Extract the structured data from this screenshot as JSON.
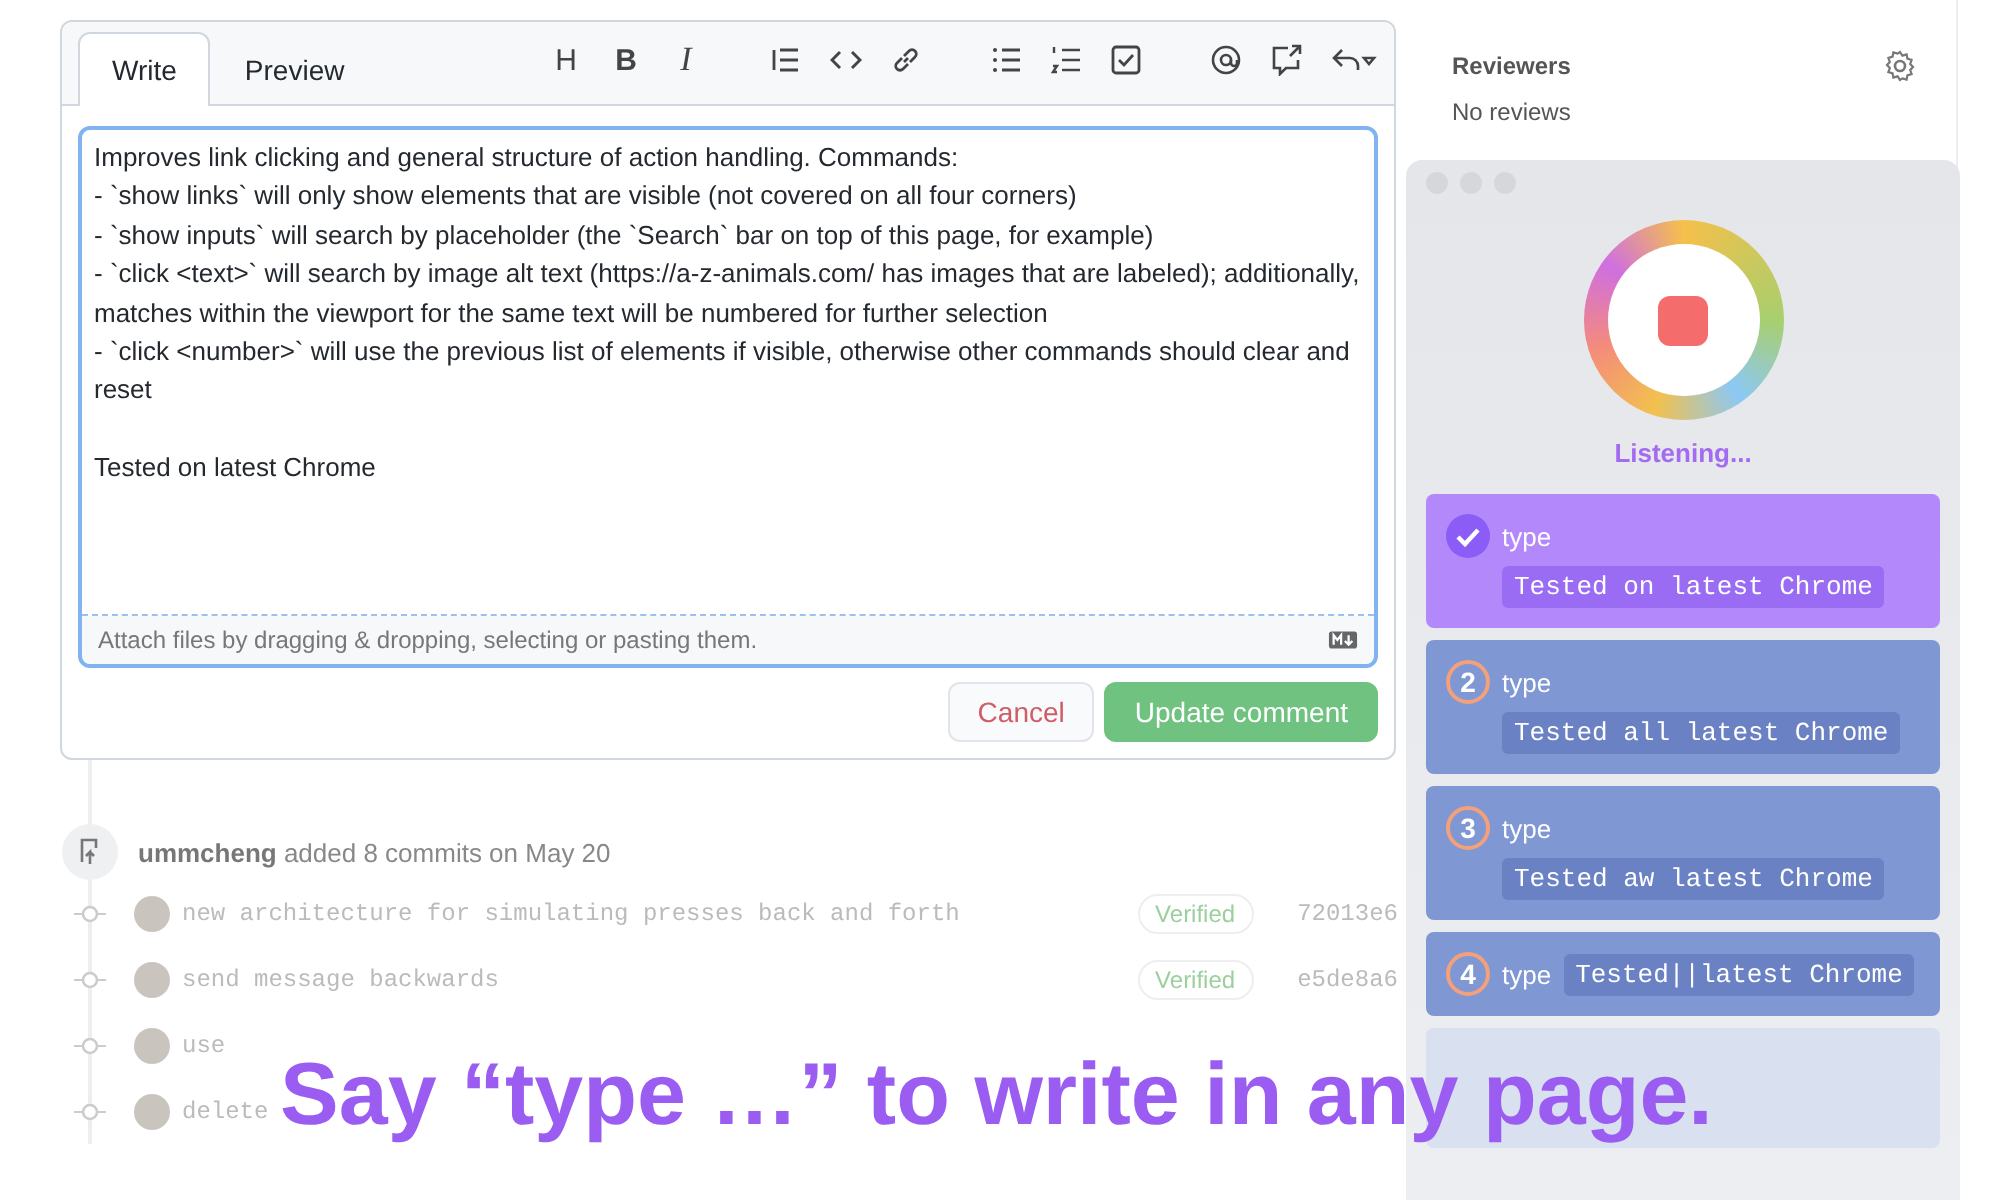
{
  "editor": {
    "tabs": [
      {
        "label": "Write",
        "selected": true
      },
      {
        "label": "Preview",
        "selected": false
      }
    ],
    "toolbar_letters": [
      "H",
      "B",
      "I"
    ],
    "text": "Improves link clicking and general structure of action handling. Commands:\n- `show links` will only show elements that are visible (not covered on all four corners)\n- `show inputs` will search by placeholder (the `Search` bar on top of this page, for example)\n- `click <text>` will search by image alt text (https://a-z-animals.com/ has images that are labeled); additionally, matches within the viewport for the same text will be numbered for further selection\n- `click <number>` will use the previous list of elements if visible, otherwise other commands should clear and reset\n\nTested on latest Chrome",
    "attach_hint": "Attach files by dragging & dropping, selecting or pasting them.",
    "buttons": [
      {
        "label": "Cancel",
        "kind": "secondary"
      },
      {
        "label": "Update comment",
        "kind": "primary"
      }
    ]
  },
  "timeline": {
    "event": {
      "user": "ummcheng",
      "action": "added 8 commits on May 20"
    },
    "commits": [
      {
        "message": "new architecture for simulating presses back and forth",
        "badge": "Verified",
        "hash": "72013e6"
      },
      {
        "message": "send message backwards",
        "badge": "Verified",
        "hash": "e5de8a6"
      },
      {
        "message": "use"
      },
      {
        "message": "delete"
      }
    ]
  },
  "sidebar": {
    "title": "Reviewers",
    "value": "No reviews"
  },
  "voice_panel": {
    "status": "Listening...",
    "items": [
      {
        "verb": "type",
        "text": "Tested on latest Chrome",
        "selected": true
      },
      {
        "number": "2",
        "verb": "type",
        "text": "Tested all latest Chrome",
        "selected": false
      },
      {
        "number": "3",
        "verb": "type",
        "text": "Tested aw latest Chrome",
        "selected": false
      },
      {
        "number": "4",
        "verb": "type",
        "text": "Tested||latest Chrome",
        "selected": false
      }
    ]
  },
  "caption": "Say “type …” to write in any page."
}
